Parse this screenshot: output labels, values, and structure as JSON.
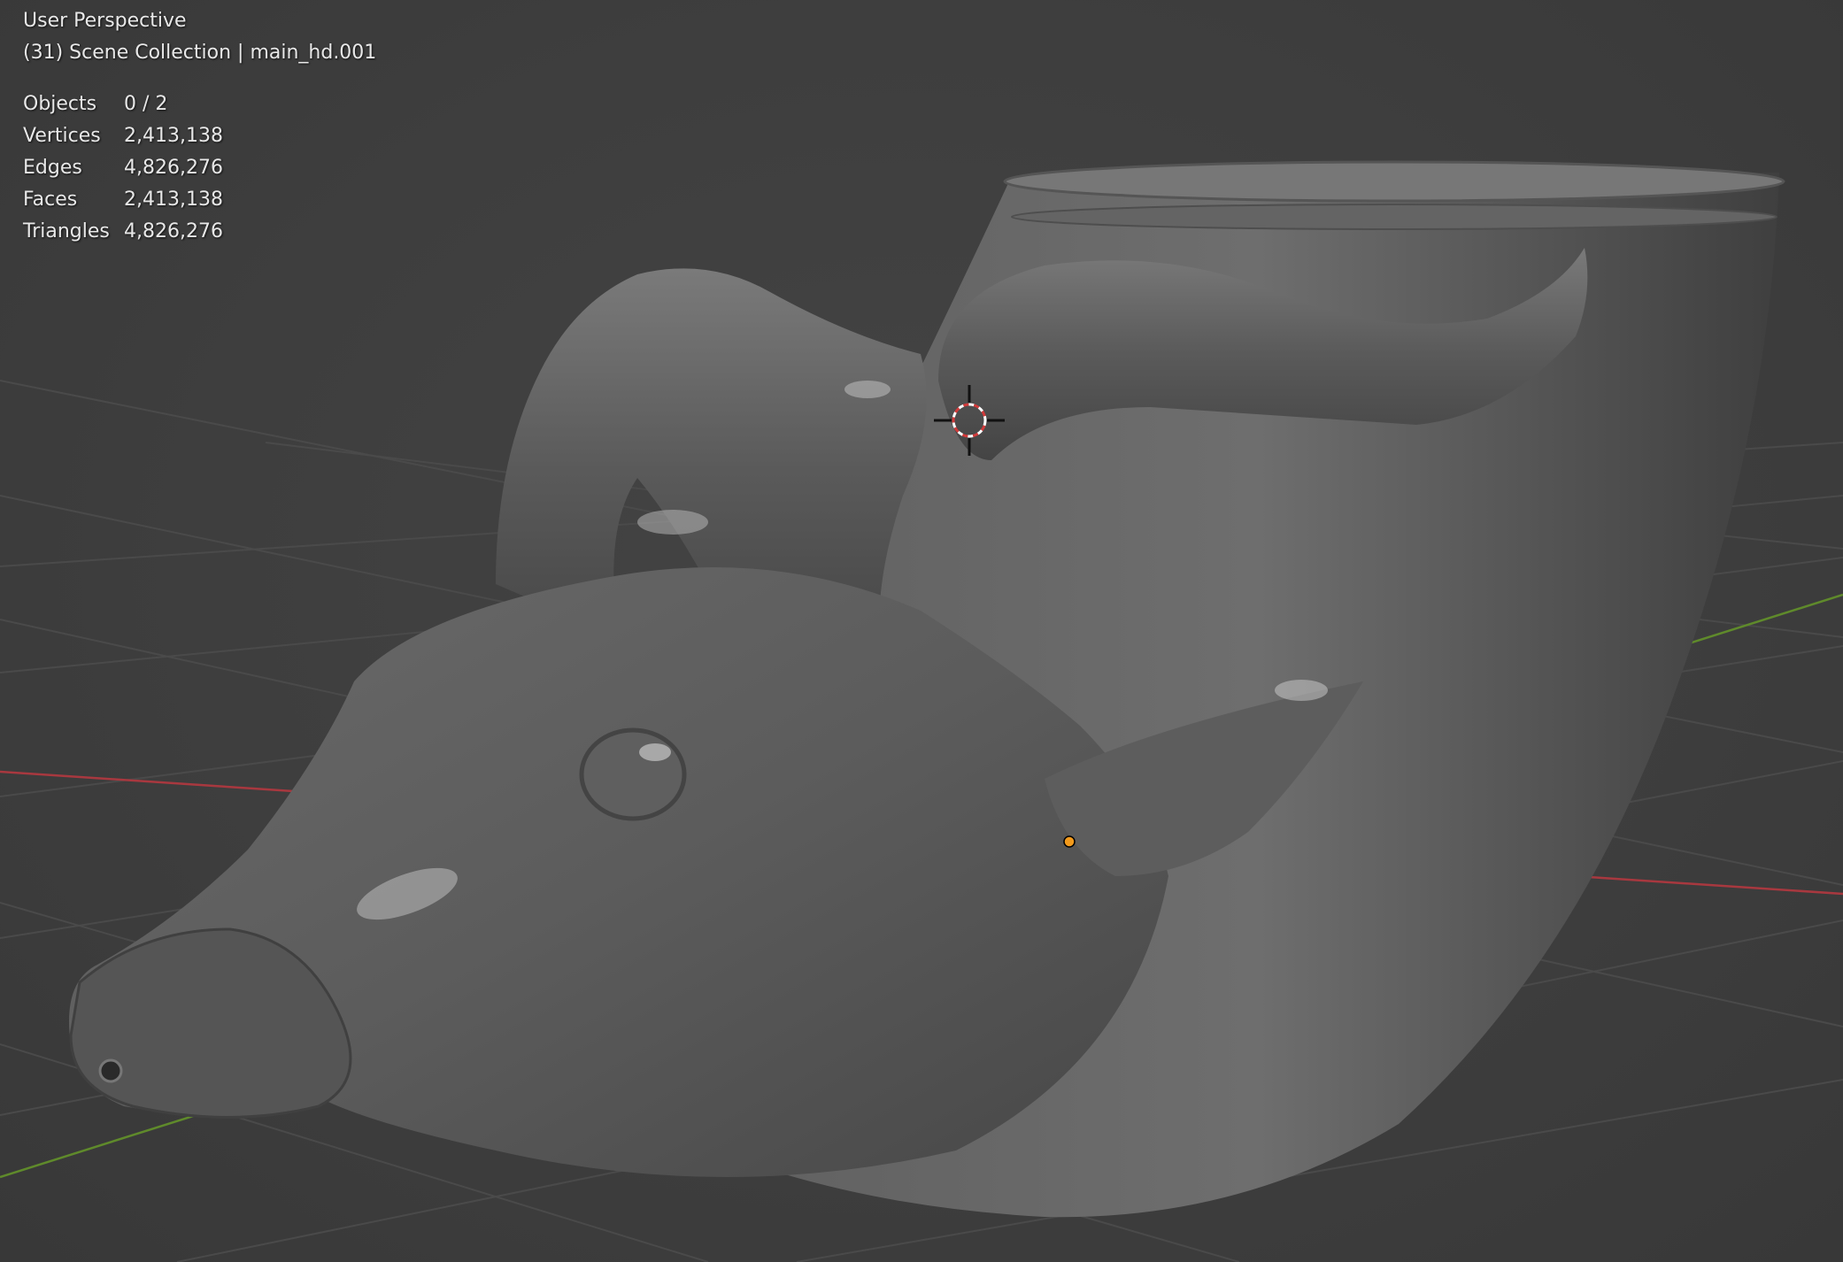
{
  "viewport": {
    "view_name": "User Perspective",
    "collection_info": "(31) Scene Collection | main_hd.001"
  },
  "stats": [
    {
      "label": "Objects",
      "value": "0 / 2"
    },
    {
      "label": "Vertices",
      "value": "2,413,138"
    },
    {
      "label": "Edges",
      "value": "4,826,276"
    },
    {
      "label": "Faces",
      "value": "2,413,138"
    },
    {
      "label": "Triangles",
      "value": "4,826,276"
    }
  ],
  "colors": {
    "background": "#3d3d3d",
    "grid_line": "#4a4a4a",
    "x_axis": "#a8383f",
    "y_axis": "#5f8a2b",
    "model": "#6c6c6c",
    "origin": "#f29a1c",
    "cursor": "#d8d8d8"
  },
  "icons": [
    "3d-cursor-icon",
    "object-origin-icon"
  ]
}
